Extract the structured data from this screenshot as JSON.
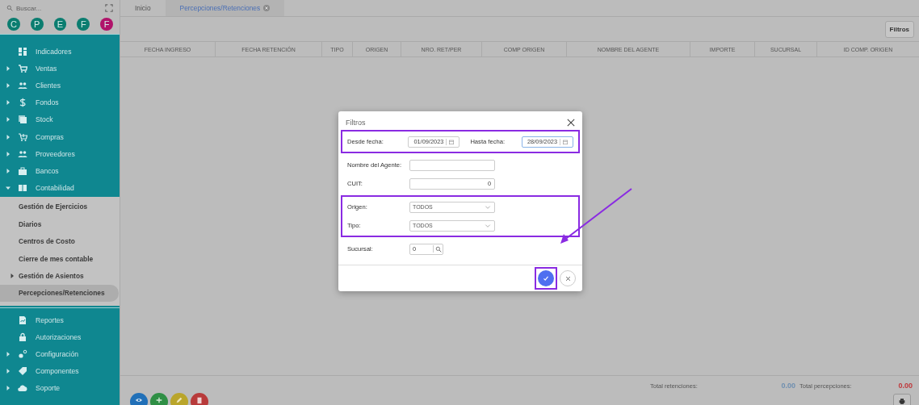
{
  "sidebar": {
    "search": {
      "placeholder": "Buscar..."
    },
    "shortcuts": [
      {
        "letter": "C",
        "color": "#0b7d70"
      },
      {
        "letter": "P",
        "color": "#0b7d70"
      },
      {
        "letter": "E",
        "color": "#0b7d70"
      },
      {
        "letter": "F",
        "color": "#0b7d70"
      },
      {
        "letter": "F",
        "color": "#b0136a"
      }
    ],
    "items": [
      {
        "label": "Indicadores"
      },
      {
        "label": "Ventas",
        "expanded": false
      },
      {
        "label": "Clientes",
        "expanded": false
      },
      {
        "label": "Fondos",
        "expanded": false
      },
      {
        "label": "Stock",
        "expanded": false
      },
      {
        "label": "Compras",
        "expanded": false
      },
      {
        "label": "Proveedores",
        "expanded": false
      },
      {
        "label": "Bancos",
        "expanded": false
      },
      {
        "label": "Contabilidad",
        "expanded": true,
        "children": [
          {
            "label": "Gestión de Ejercicios",
            "selected": false
          },
          {
            "label": "Diarios",
            "selected": false
          },
          {
            "label": "Centros de Costo",
            "selected": false
          },
          {
            "label": "Cierre de mes contable",
            "selected": false
          },
          {
            "label": "Gestión de Asientos",
            "selected": false,
            "expanded": false
          },
          {
            "label": "Percepciones/Retenciones",
            "selected": true
          }
        ]
      },
      {
        "label": "Reportes"
      },
      {
        "label": "Autorizaciones"
      },
      {
        "label": "Configuración",
        "expanded": false
      },
      {
        "label": "Componentes",
        "expanded": false
      },
      {
        "label": "Soporte",
        "expanded": false
      }
    ]
  },
  "tabs": [
    {
      "label": "Inicio",
      "selected": false
    },
    {
      "label": "Percepciones/Retenciones",
      "selected": true,
      "closable": true
    }
  ],
  "toolbar": {
    "filter_button": "Filtros"
  },
  "table": {
    "columns": [
      "FECHA INGRESO",
      "FECHA RETENCIÓN",
      "TIPO",
      "ORIGEN",
      "NRO. RET/PER",
      "COMP ORIGEN",
      "NOMBRE DEL AGENTE",
      "IMPORTE",
      "SUCURSAL",
      "ID COMP. ORIGEN"
    ]
  },
  "footer": {
    "totals": [
      {
        "label": "Total retenciones:",
        "value": "0.00",
        "color": "#6f8fb0"
      },
      {
        "label": "Total percepciones:",
        "value": "0.00",
        "color": "#c0393c"
      }
    ],
    "actions": [
      {
        "kind": "view",
        "color": "#2170b8"
      },
      {
        "kind": "add",
        "color": "#2f8f45"
      },
      {
        "kind": "edit",
        "color": "#b9a52b"
      },
      {
        "kind": "delete",
        "color": "#b83a3a"
      }
    ]
  },
  "dialog": {
    "title": "Filtros",
    "groups": [
      {
        "highlighted": true,
        "rows": [
          {
            "kind": "date-pair",
            "fields": [
              {
                "label": "Desde fecha:",
                "value": "01/09/2023",
                "focused": false
              },
              {
                "label": "Hasta fecha:",
                "value": "28/09/2023",
                "focused": true
              }
            ]
          }
        ]
      },
      {
        "highlighted": false,
        "rows": [
          {
            "kind": "text",
            "label": "Nombre del Agente:"
          },
          {
            "kind": "number",
            "label": "CUIT:",
            "value": "0"
          }
        ]
      },
      {
        "highlighted": true,
        "rows": [
          {
            "kind": "select",
            "label": "Origen:",
            "value": "TODOS"
          },
          {
            "kind": "select",
            "label": "Tipo:",
            "value": "TODOS"
          }
        ]
      },
      {
        "highlighted": false,
        "rows": [
          {
            "kind": "lookup",
            "label": "Sucursal:",
            "value": "0"
          }
        ]
      }
    ],
    "confirm_highlighted": true,
    "annotation_arrow": true
  }
}
